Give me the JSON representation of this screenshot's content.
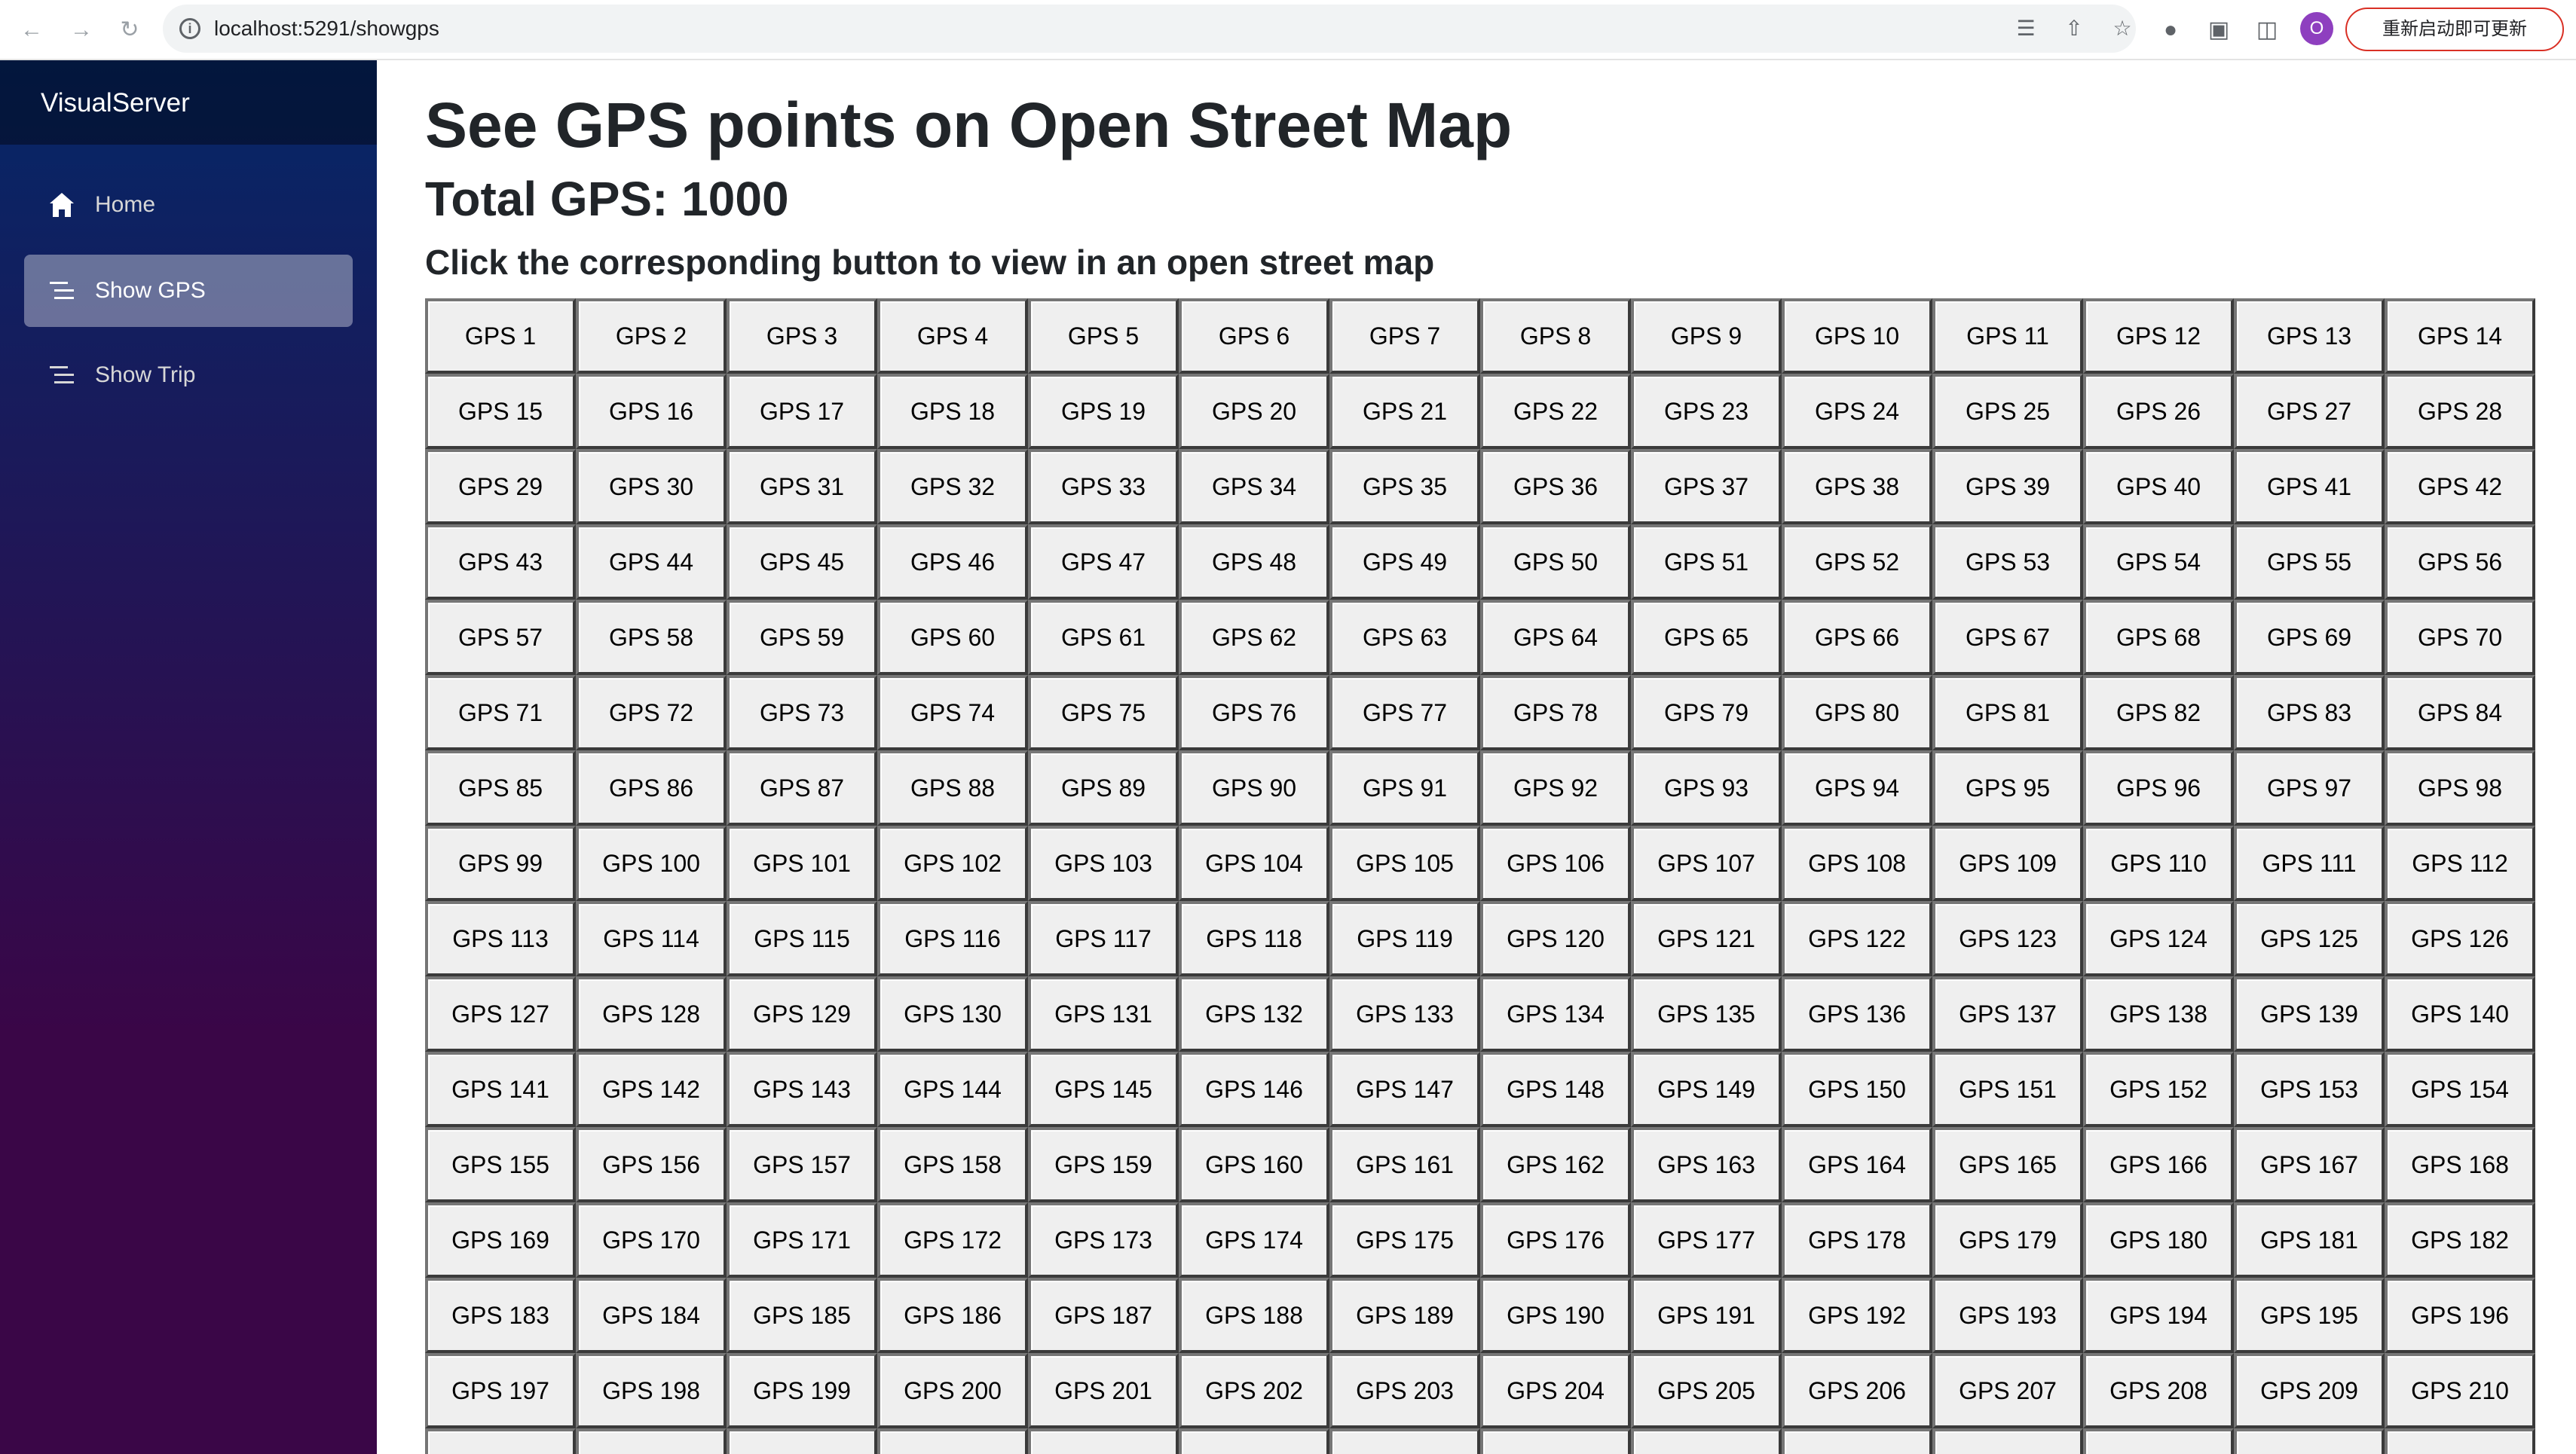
{
  "browser": {
    "url": "localhost:5291/showgps",
    "avatar_initial": "O",
    "update_label": "重新启动即可更新"
  },
  "sidebar": {
    "brand": "VisualServer",
    "items": [
      {
        "label": "Home",
        "icon": "home-icon",
        "active": false
      },
      {
        "label": "Show GPS",
        "icon": "list-icon",
        "active": true
      },
      {
        "label": "Show Trip",
        "icon": "list-icon",
        "active": false
      }
    ]
  },
  "main": {
    "title": "See GPS points on Open Street Map",
    "total": "Total GPS: 1000",
    "instruction": "Click the corresponding button to view in an open street map",
    "button_prefix": "GPS",
    "visible_button_count": 224,
    "columns": 14
  },
  "colors": {
    "sidebar_top": "#052767",
    "sidebar_bottom": "#3a0647",
    "update_border": "#d93025",
    "avatar": "#8e3fbf"
  }
}
